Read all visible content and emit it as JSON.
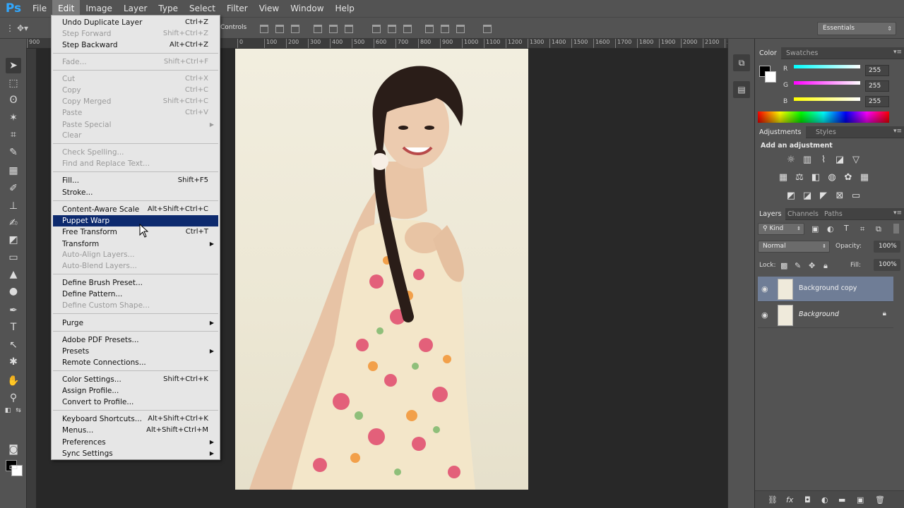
{
  "app": {
    "logo": "Ps"
  },
  "menubar": {
    "items": [
      "File",
      "Edit",
      "Image",
      "Layer",
      "Type",
      "Select",
      "Filter",
      "View",
      "Window",
      "Help"
    ],
    "active": "Edit"
  },
  "options_bar": {
    "show_transform_controls": "Controls",
    "workspace": "Essentials"
  },
  "ruler": {
    "marks": [
      "900",
      "0",
      "100",
      "200",
      "300",
      "400",
      "500",
      "600",
      "700",
      "800",
      "900",
      "1000",
      "1100",
      "1200",
      "1300",
      "1400",
      "1500",
      "1600",
      "1700",
      "1800",
      "1900",
      "2000",
      "2100",
      "2"
    ]
  },
  "edit_menu": {
    "undo": {
      "label": "Undo Duplicate Layer",
      "shortcut": "Ctrl+Z"
    },
    "step_forward": {
      "label": "Step Forward",
      "shortcut": "Shift+Ctrl+Z"
    },
    "step_backward": {
      "label": "Step Backward",
      "shortcut": "Alt+Ctrl+Z"
    },
    "fade": {
      "label": "Fade...",
      "shortcut": "Shift+Ctrl+F"
    },
    "cut": {
      "label": "Cut",
      "shortcut": "Ctrl+X"
    },
    "copy": {
      "label": "Copy",
      "shortcut": "Ctrl+C"
    },
    "copy_merged": {
      "label": "Copy Merged",
      "shortcut": "Shift+Ctrl+C"
    },
    "paste": {
      "label": "Paste",
      "shortcut": "Ctrl+V"
    },
    "paste_special": {
      "label": "Paste Special"
    },
    "clear": {
      "label": "Clear"
    },
    "check_spelling": {
      "label": "Check Spelling..."
    },
    "find_replace": {
      "label": "Find and Replace Text..."
    },
    "fill": {
      "label": "Fill...",
      "shortcut": "Shift+F5"
    },
    "stroke": {
      "label": "Stroke..."
    },
    "content_aware_scale": {
      "label": "Content-Aware Scale",
      "shortcut": "Alt+Shift+Ctrl+C"
    },
    "puppet_warp": {
      "label": "Puppet Warp"
    },
    "free_transform": {
      "label": "Free Transform",
      "shortcut": "Ctrl+T"
    },
    "transform": {
      "label": "Transform"
    },
    "auto_align": {
      "label": "Auto-Align Layers..."
    },
    "auto_blend": {
      "label": "Auto-Blend Layers..."
    },
    "define_brush": {
      "label": "Define Brush Preset..."
    },
    "define_pattern": {
      "label": "Define Pattern..."
    },
    "define_custom_shape": {
      "label": "Define Custom Shape..."
    },
    "purge": {
      "label": "Purge"
    },
    "pdf_presets": {
      "label": "Adobe PDF Presets..."
    },
    "presets": {
      "label": "Presets"
    },
    "remote_connections": {
      "label": "Remote Connections..."
    },
    "color_settings": {
      "label": "Color Settings...",
      "shortcut": "Shift+Ctrl+K"
    },
    "assign_profile": {
      "label": "Assign Profile..."
    },
    "convert_profile": {
      "label": "Convert to Profile..."
    },
    "keyboard_shortcuts": {
      "label": "Keyboard Shortcuts...",
      "shortcut": "Alt+Shift+Ctrl+K"
    },
    "menus": {
      "label": "Menus...",
      "shortcut": "Alt+Shift+Ctrl+M"
    },
    "preferences": {
      "label": "Preferences"
    },
    "sync_settings": {
      "label": "Sync Settings"
    }
  },
  "color_panel": {
    "tabs": [
      "Color",
      "Swatches"
    ],
    "r_label": "R",
    "g_label": "G",
    "b_label": "B",
    "r": "255",
    "g": "255",
    "b": "255",
    "r_color": "#00ffff",
    "g_color": "#ff00ff",
    "b_color": "#ffff00"
  },
  "adjustments_panel": {
    "tabs": [
      "Adjustments",
      "Styles"
    ],
    "heading": "Add an adjustment"
  },
  "layers_panel": {
    "tabs": [
      "Layers",
      "Channels",
      "Paths"
    ],
    "filter": "Kind",
    "blend_mode": "Normal",
    "opacity_label": "Opacity:",
    "opacity": "100%",
    "lock_label": "Lock:",
    "fill_label": "Fill:",
    "fill": "100%",
    "layers": [
      {
        "name": "Background copy",
        "selected": true
      },
      {
        "name": "Background",
        "selected": false
      }
    ]
  },
  "tools": [
    "move-tool",
    "marquee-tool",
    "lasso-tool",
    "magic-wand-tool",
    "crop-tool",
    "eyedropper-tool",
    "healing-brush-tool",
    "brush-tool",
    "clone-stamp-tool",
    "history-brush-tool",
    "eraser-tool",
    "gradient-tool",
    "blur-tool",
    "dodge-tool",
    "pen-tool",
    "type-tool",
    "path-selection-tool",
    "shape-tool",
    "hand-tool",
    "zoom-tool"
  ]
}
